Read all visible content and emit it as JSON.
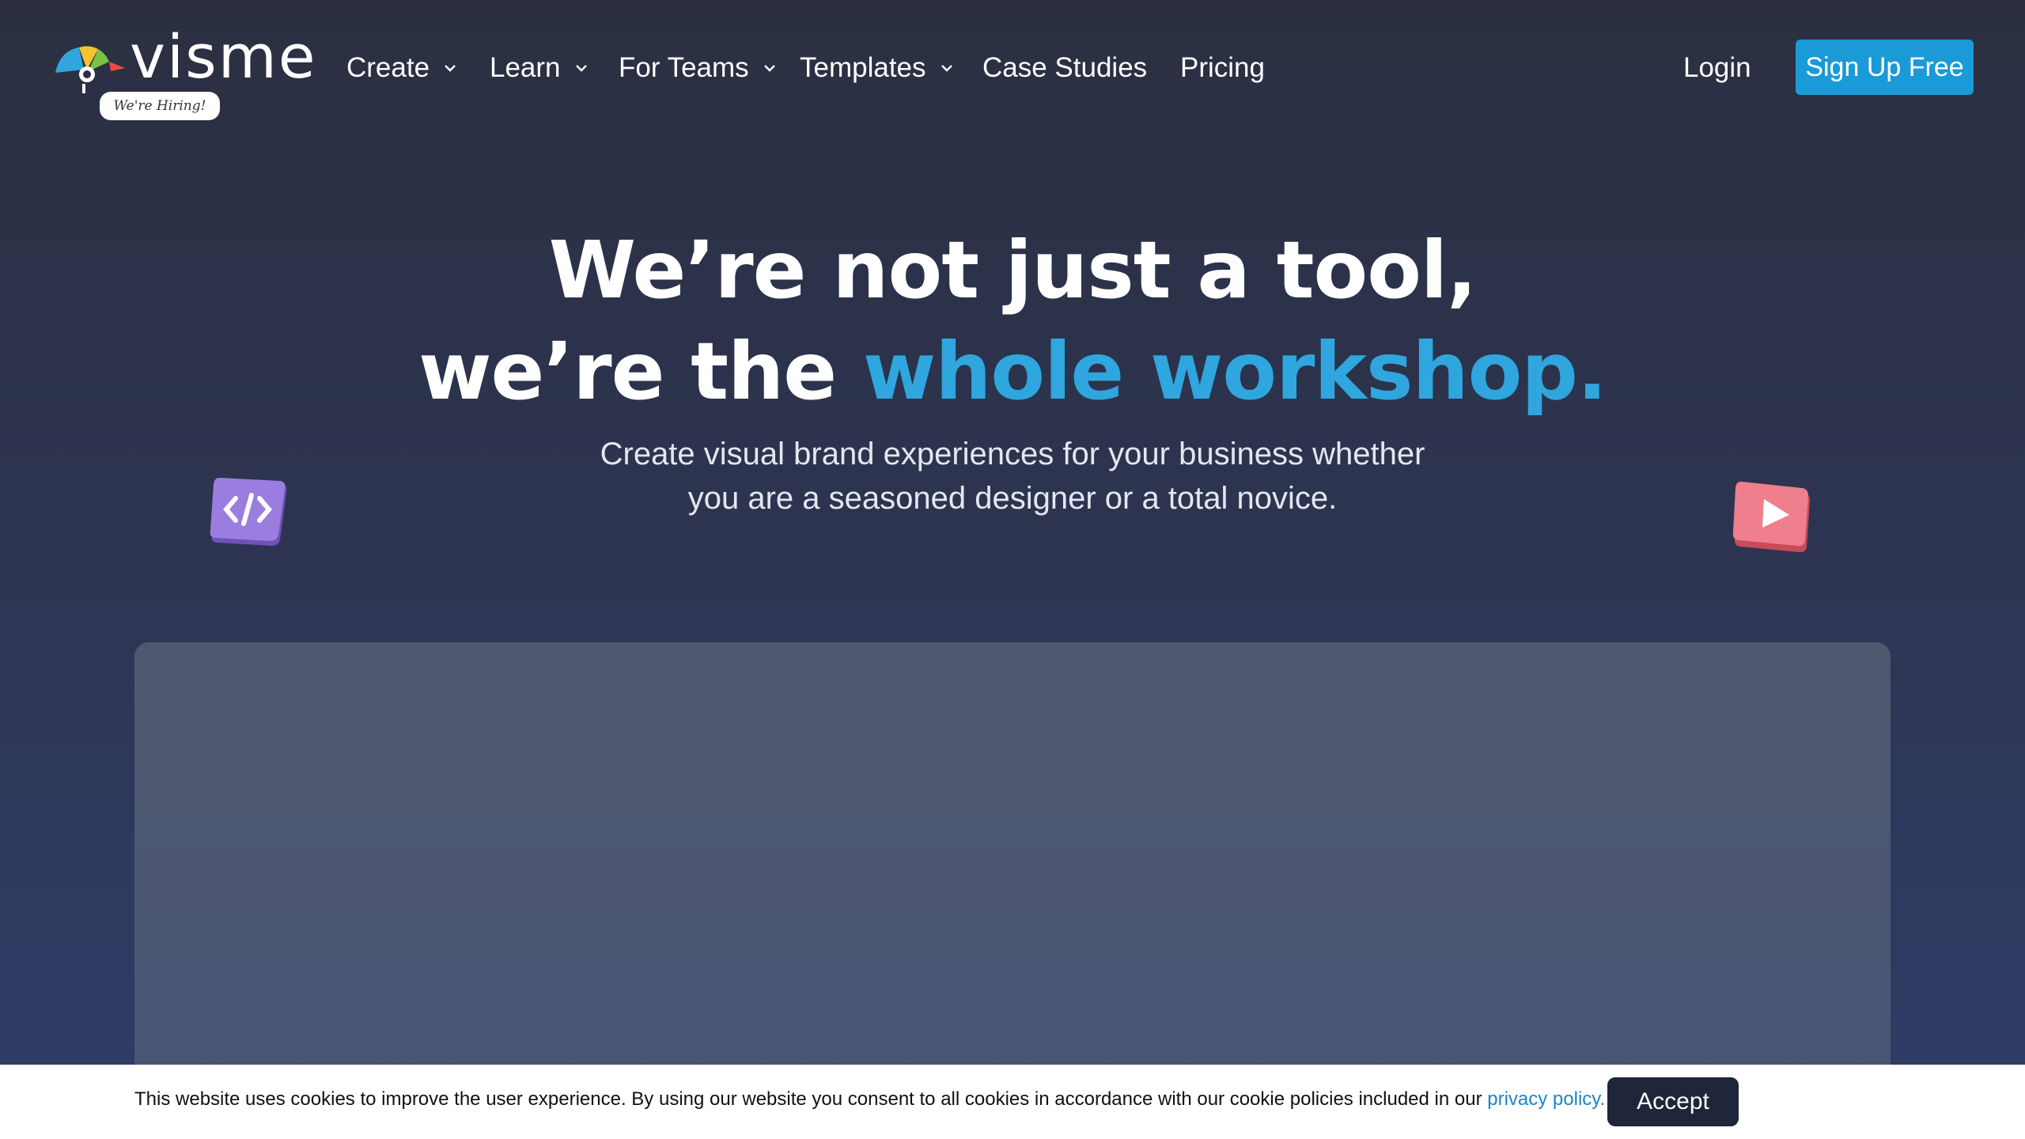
{
  "brand": {
    "logo_text": "visme",
    "hiring_badge": "We're Hiring!"
  },
  "nav": {
    "items": [
      {
        "label": "Create",
        "has_dropdown": true
      },
      {
        "label": "Learn",
        "has_dropdown": true
      },
      {
        "label": "For Teams",
        "has_dropdown": true
      },
      {
        "label": "Templates",
        "has_dropdown": true
      },
      {
        "label": "Case Studies",
        "has_dropdown": false
      },
      {
        "label": "Pricing",
        "has_dropdown": false
      }
    ],
    "login": "Login",
    "signup": "Sign Up Free"
  },
  "hero": {
    "title_line1": "We’re not just a tool,",
    "title_line2_plain": "we’re the ",
    "title_line2_accent": "whole workshop.",
    "subtitle_line1": "Create visual brand experiences for your business whether",
    "subtitle_line2": "you are a seasoned designer or a total novice."
  },
  "icons": {
    "code": "code-icon",
    "play": "play-icon",
    "chevron": "chevron-down-icon"
  },
  "cookie": {
    "text": "This website uses cookies to improve the user experience. By using our website you consent to all cookies in accordance with our cookie policies included in our ",
    "link": "privacy policy.",
    "accept": "Accept"
  },
  "colors": {
    "accent": "#2fa6dd",
    "signup_bg": "#1a9ad6",
    "accept_bg": "#1f2639",
    "link": "#1a86c8"
  }
}
